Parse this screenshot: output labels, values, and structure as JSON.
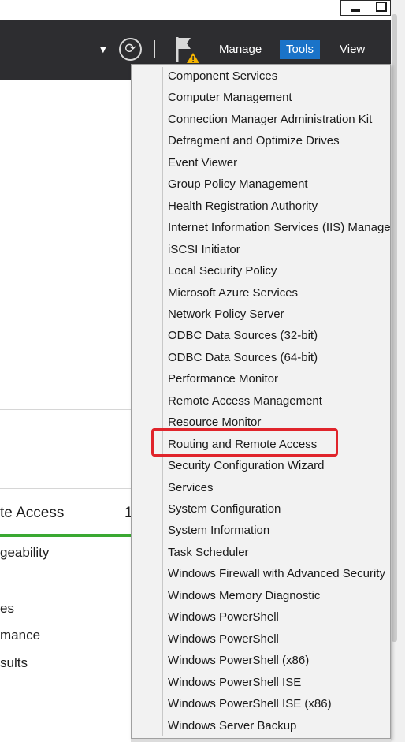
{
  "header": {
    "menu": [
      {
        "label": "Manage"
      },
      {
        "label": "Tools",
        "active": true
      },
      {
        "label": "View"
      }
    ],
    "refresh_icon": "refresh-icon",
    "flag_icon": "notification-flag-warning-icon",
    "dropdown_icon": "dropdown-arrow-icon"
  },
  "left_panel": {
    "tile_title": "te Access",
    "tile_count": "1",
    "links": [
      "geability",
      "es",
      "mance",
      "sults"
    ],
    "accent_color": "#3aa832"
  },
  "tools_menu": {
    "items": [
      "Component Services",
      "Computer Management",
      "Connection Manager Administration Kit",
      "Defragment and Optimize Drives",
      "Event Viewer",
      "Group Policy Management",
      "Health Registration Authority",
      "Internet Information Services (IIS) Manager",
      "iSCSI Initiator",
      "Local Security Policy",
      "Microsoft Azure Services",
      "Network Policy Server",
      "ODBC Data Sources (32-bit)",
      "ODBC Data Sources (64-bit)",
      "Performance Monitor",
      "Remote Access Management",
      "Resource Monitor",
      "Routing and Remote Access",
      "Security Configuration Wizard",
      "Services",
      "System Configuration",
      "System Information",
      "Task Scheduler",
      "Windows Firewall with Advanced Security",
      "Windows Memory Diagnostic",
      "Windows PowerShell",
      "Windows PowerShell",
      "Windows PowerShell (x86)",
      "Windows PowerShell ISE",
      "Windows PowerShell ISE (x86)",
      "Windows Server Backup"
    ],
    "highlighted_item": "Routing and Remote Access",
    "highlight_color": "#e0242b"
  },
  "colors": {
    "header_bg": "#2d2d30",
    "active_menu": "#1a73c8",
    "menu_bg": "#f2f2f2"
  }
}
